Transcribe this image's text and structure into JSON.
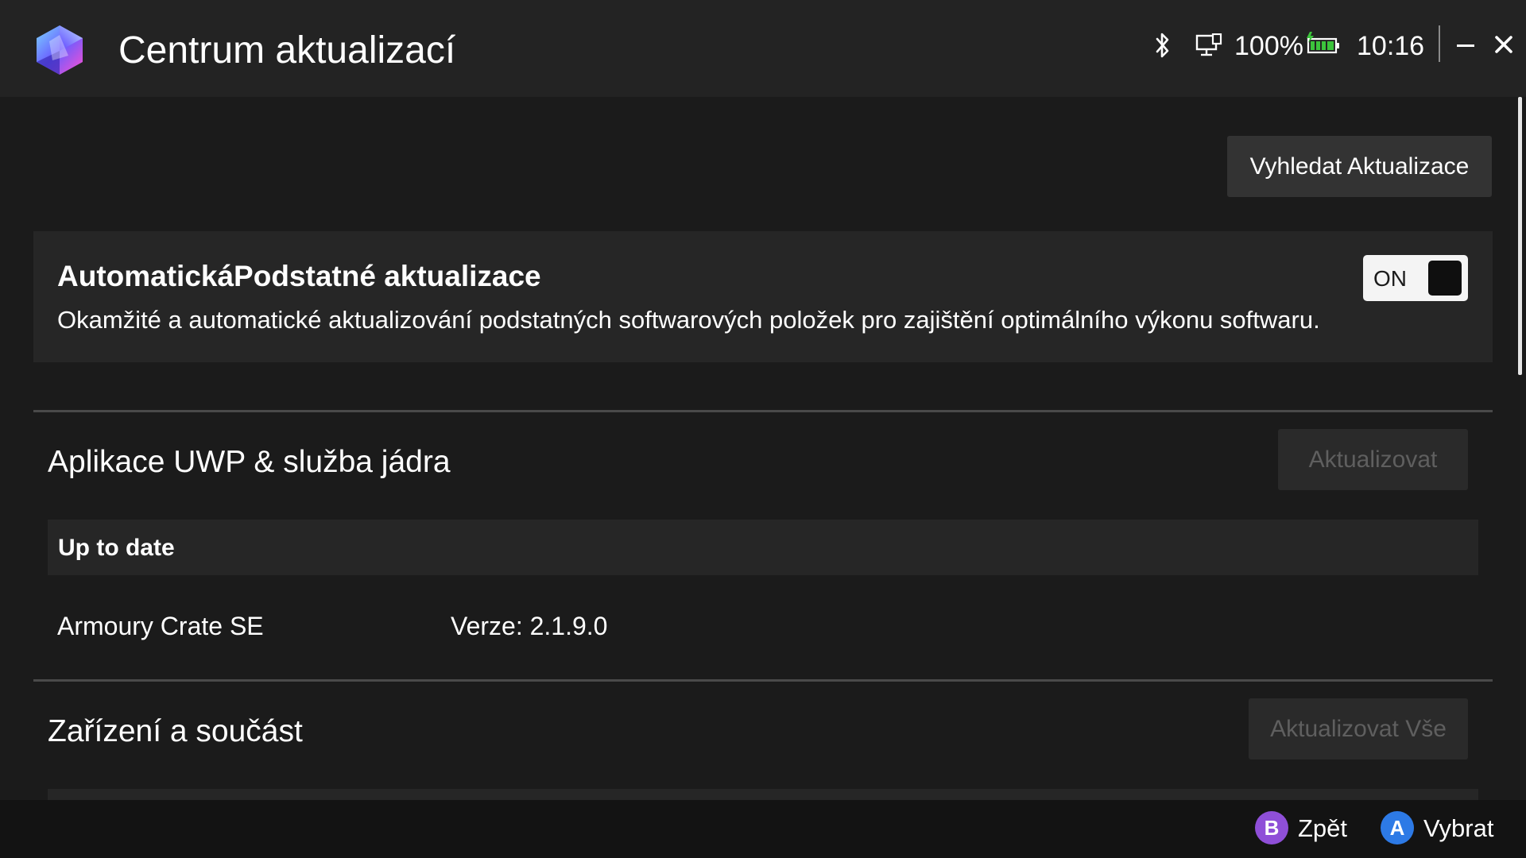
{
  "window": {
    "title": "Centrum aktualizací",
    "logo_icon": "armoury-crate-logo-icon"
  },
  "status_tray": {
    "bluetooth_icon": "bluetooth-icon",
    "display_icon": "display-icon",
    "battery_percent": "100%",
    "battery_icon": "battery-charging-icon",
    "battery_color": "#3cc43c",
    "time": "10:16",
    "minimize_icon": "minimize-icon",
    "close_icon": "close-icon"
  },
  "toolbar": {
    "check_updates_label": "Vyhledat Aktualizace"
  },
  "auto_update": {
    "title": "AutomatickáPodstatné aktualizace",
    "description": "Okamžité a automatické aktualizování podstatných softwarových položek pro zajištění optimálního výkonu softwaru.",
    "toggle_label": "ON",
    "toggle_on": true
  },
  "sections": [
    {
      "title": "Aplikace UWP & služba jádra",
      "button_label": "Aktualizovat",
      "button_enabled": false,
      "status": "Up to date",
      "items": [
        {
          "name": "Armoury Crate SE",
          "version": "Verze: 2.1.9.0"
        }
      ]
    },
    {
      "title": "Zařízení a součást",
      "button_label": "Aktualizovat Vše",
      "button_enabled": false
    }
  ],
  "footer": {
    "back": {
      "key": "B",
      "label": "Zpět",
      "color": "#8f4fd8"
    },
    "select": {
      "key": "A",
      "label": "Vybrat",
      "color": "#2d7ae6"
    }
  }
}
